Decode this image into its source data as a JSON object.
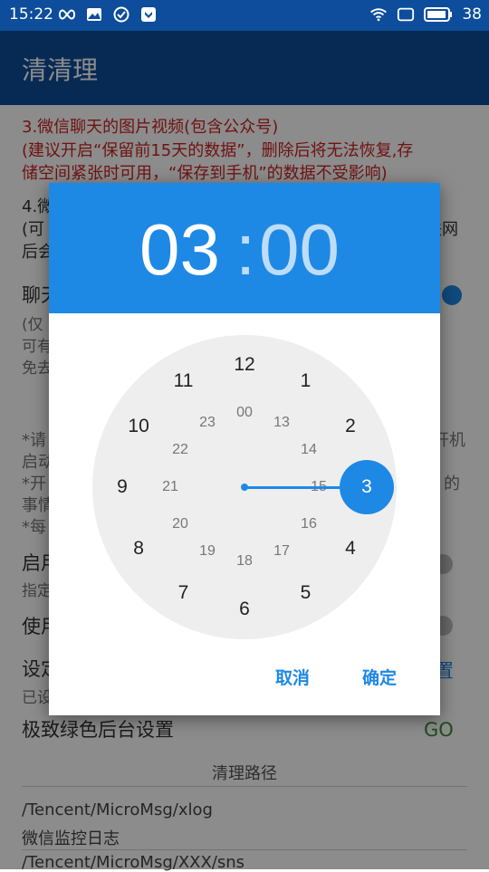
{
  "status_bar": {
    "time": "15:22",
    "battery": "38",
    "icons": [
      "infinity-icon",
      "mail-icon",
      "check-circle-icon",
      "shield-icon",
      "wifi-icon",
      "screen-icon",
      "battery-icon"
    ]
  },
  "app_bar": {
    "title": "清清理"
  },
  "background": {
    "item3_title": "3.微信聊天的图片视频(包含公众号)",
    "item3_note_1": "(建议开启“保留前15天的数据”，删除后将无法恢复,存",
    "item3_note_2": "储空间紧张时可用，“保存到手机”的数据不受影响)",
    "item4_title": "4.微",
    "item4_note_1": "(可",
    "item4_note_1_right": "联网",
    "item4_note_2": "后会",
    "chat_row_label": "聊天",
    "chat_note_1": "(仅",
    "chat_note_2": "可有",
    "chat_note_3": "免去",
    "tip_1_left": "*请",
    "tip_1_right": "开机",
    "tip_1b": "启动",
    "tip_2_left": "*开",
    "tip_2_right": "的",
    "tip_2b": "事情",
    "tip_3": "*每",
    "start_label": "启用",
    "start_sub": "指定",
    "use_label": "使用",
    "set_label": "设定",
    "set_right": "置",
    "set_sub": "已设",
    "extreme_label": "极致绿色后台设置",
    "go_label": "GO",
    "paths_header": "清理路径",
    "path1": "/Tencent/MicroMsg/xlog",
    "path1_desc": "微信监控日志",
    "path2": "/Tencent/MicroMsg/XXX/sns"
  },
  "time_picker": {
    "hour": "03",
    "separator": ":",
    "minute": "00",
    "selected_hour": "3",
    "outer_hours": [
      "12",
      "1",
      "2",
      "3",
      "4",
      "5",
      "6",
      "7",
      "8",
      "9",
      "10",
      "11"
    ],
    "inner_hours": [
      "00",
      "13",
      "14",
      "15",
      "16",
      "17",
      "18",
      "19",
      "20",
      "21",
      "22",
      "23"
    ],
    "cancel_label": "取消",
    "ok_label": "确定",
    "accent_color": "#1e88e5"
  }
}
